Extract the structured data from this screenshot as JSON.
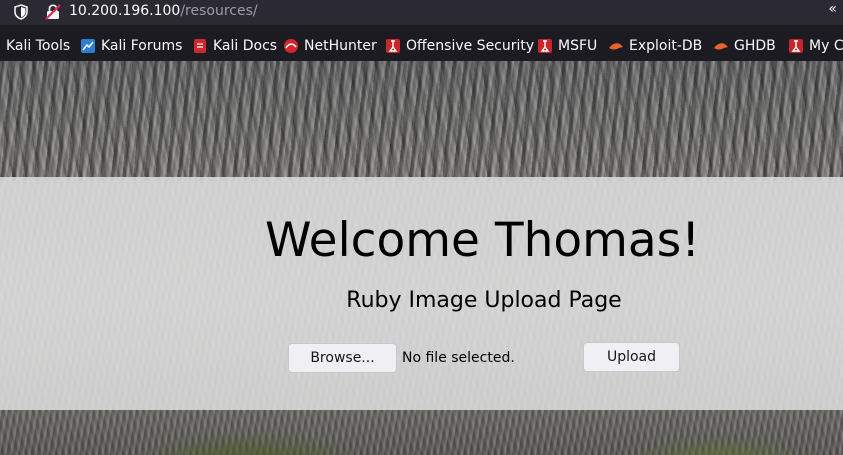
{
  "browser": {
    "url_host": "10.200.196.100",
    "url_path": "/resources/",
    "overflow": "«"
  },
  "bookmarks": [
    {
      "label": "Kali Tools",
      "icon": "kali-icon",
      "color": "#2d7fd3"
    },
    {
      "label": "Kali Forums",
      "icon": "kali-forums-icon",
      "color": "#2d7fd3"
    },
    {
      "label": "Kali Docs",
      "icon": "kali-docs-icon",
      "color": "#d3272f"
    },
    {
      "label": "NetHunter",
      "icon": "nethunter-icon",
      "color": "#d3272f"
    },
    {
      "label": "Offensive Security",
      "icon": "offsec-icon",
      "color": "#c8262c"
    },
    {
      "label": "MSFU",
      "icon": "offsec-icon",
      "color": "#c8262c"
    },
    {
      "label": "Exploit-DB",
      "icon": "exploitdb-icon",
      "color": "#e8632b"
    },
    {
      "label": "GHDB",
      "icon": "exploitdb-icon",
      "color": "#e8632b"
    },
    {
      "label": "My C",
      "icon": "offsec-icon",
      "color": "#c8262c"
    }
  ],
  "page": {
    "headline": "Welcome Thomas!",
    "subheading": "Ruby Image Upload Page",
    "browse_label": "Browse...",
    "no_file_text": "No file selected.",
    "upload_label": "Upload"
  }
}
